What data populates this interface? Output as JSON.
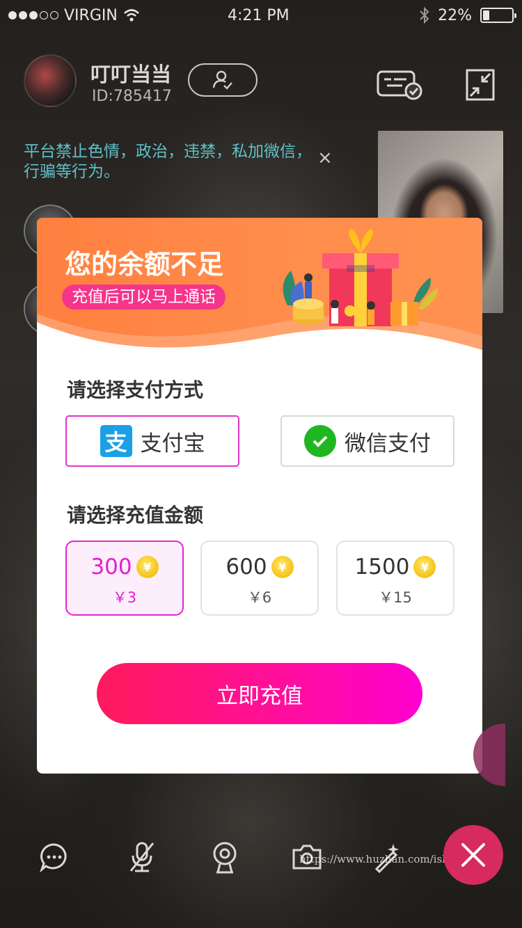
{
  "status_bar": {
    "carrier": "VIRGIN",
    "time": "4:21 PM",
    "battery": "22%",
    "battery_level": 0.22
  },
  "header": {
    "username": "叮叮当当",
    "user_id": "ID:785417"
  },
  "notice": {
    "text": "平台禁止色情，政治，违禁，私加微信，行骗等行为。",
    "close": "×"
  },
  "dialog": {
    "title": "您的余额不足",
    "subtitle": "充值后可以马上通话",
    "payment_section_title": "请选择支付方式",
    "payment_methods": [
      {
        "label": "支付宝",
        "icon": "alipay-icon",
        "selected": true
      },
      {
        "label": "微信支付",
        "icon": "wechat-pay-icon",
        "selected": false
      }
    ],
    "amount_section_title": "请选择充值金额",
    "amounts": [
      {
        "coins": "300",
        "price": "￥3",
        "selected": true
      },
      {
        "coins": "600",
        "price": "￥6",
        "selected": false
      },
      {
        "coins": "1500",
        "price": "￥15",
        "selected": false
      }
    ],
    "submit_label": "立即充值"
  },
  "watermark": "https://www.huzhan.com/ishop20445",
  "colors": {
    "accent": "#e233c9",
    "header_orange": "#ff8c4a",
    "button_start": "#ff1a5c",
    "button_end": "#ff00d0",
    "notice_text": "#5ec2c8",
    "end_call": "#d62b5c"
  },
  "icons": {
    "wifi": "wifi-icon",
    "bluetooth": "bluetooth-icon",
    "follow": "add-friend-icon",
    "message_list": "message-list-icon",
    "shrink": "shrink-icon",
    "chat": "chat-icon",
    "mute": "mic-off-icon",
    "camera_toggle": "webcam-icon",
    "flip_camera": "camera-icon",
    "beauty": "magic-wand-icon",
    "hang_up": "close-icon"
  }
}
